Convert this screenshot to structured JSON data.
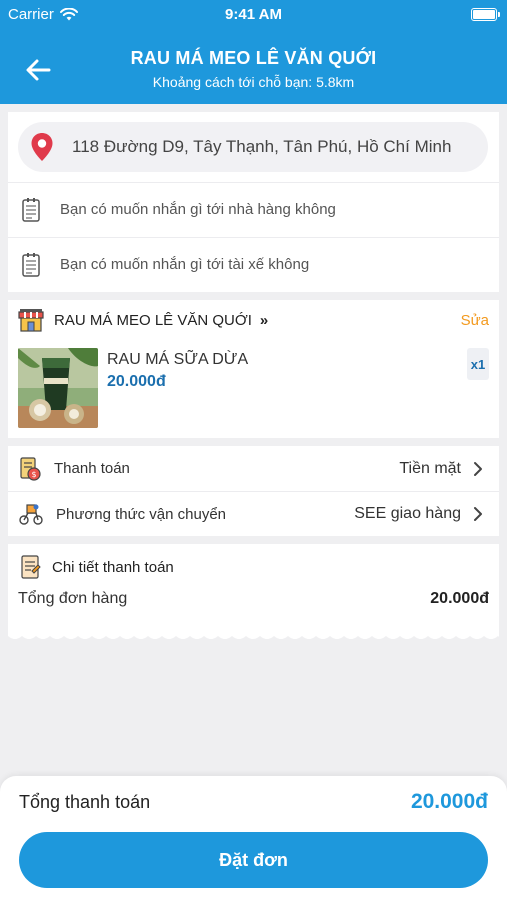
{
  "status_bar": {
    "carrier": "Carrier",
    "time": "9:41 AM"
  },
  "header": {
    "title": "RAU MÁ MEO LÊ VĂN QUỚI",
    "subtitle": "Khoảng cách tới chỗ bạn: 5.8km",
    "back_icon": "arrow-left-icon"
  },
  "address": {
    "icon": "location-pin-icon",
    "text": "118 Đường D9, Tây Thạnh, Tân Phú, Hồ Chí Minh"
  },
  "notes": [
    {
      "icon": "note-icon",
      "placeholder": "Bạn có muốn nhắn gì tới nhà hàng không"
    },
    {
      "icon": "note-icon",
      "placeholder": "Bạn có muốn nhắn gì tới tài xế không"
    }
  ],
  "shop": {
    "icon": "store-icon",
    "name": "RAU MÁ MEO LÊ VĂN QUỚI",
    "chevron": "»",
    "edit_label": "Sửa"
  },
  "items": [
    {
      "name": "RAU MÁ SỮA DỪA",
      "price": "20.000đ",
      "quantity": "x1",
      "image_icon": "drink-thumbnail"
    }
  ],
  "payment": {
    "label": "Thanh toán",
    "value": "Tiền mặt",
    "icon": "payment-icon"
  },
  "shipping": {
    "label": "Phương thức vận chuyển",
    "value": "SEE giao hàng",
    "icon": "delivery-icon"
  },
  "detail": {
    "icon": "receipt-icon",
    "title": "Chi tiết thanh toán",
    "order_total_label": "Tổng đơn hàng",
    "order_total_value": "20.000đ"
  },
  "footer": {
    "total_label": "Tổng thanh toán",
    "total_value": "20.000đ",
    "order_button": "Đặt đơn"
  },
  "colors": {
    "primary": "#1e98dc",
    "price": "#1b6fae",
    "edit": "#f39a1e",
    "pin": "#e03a4b"
  }
}
